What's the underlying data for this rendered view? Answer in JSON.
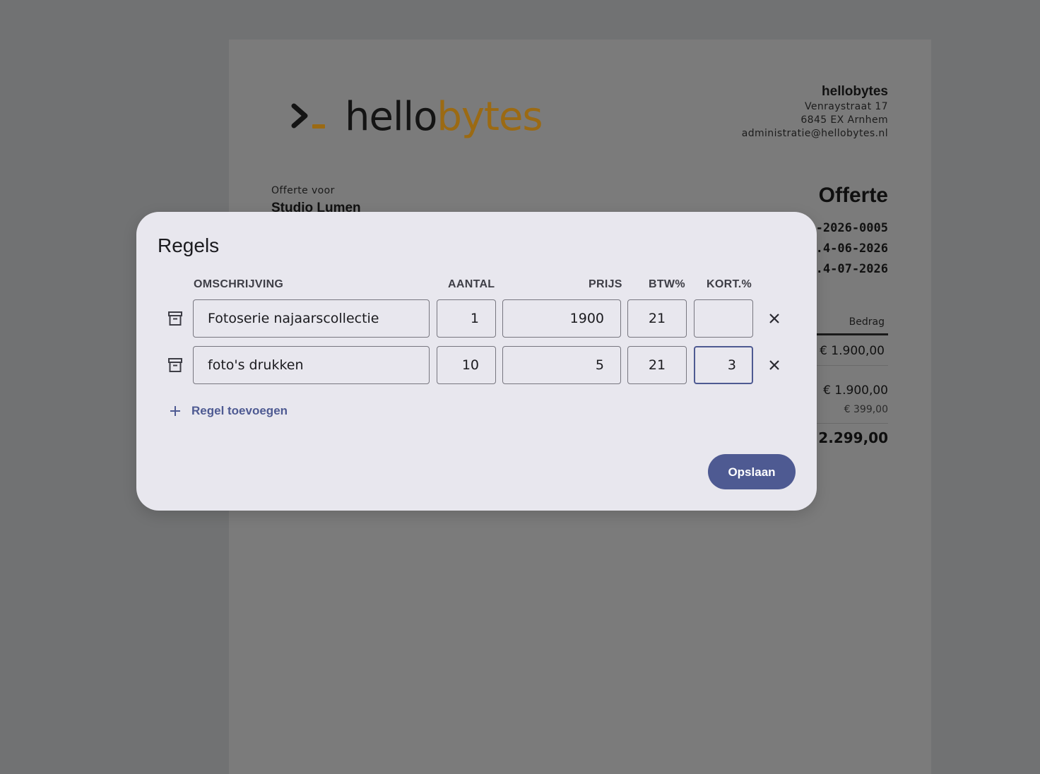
{
  "document": {
    "logo": {
      "part1": "hello",
      "part2": "bytes"
    },
    "company": {
      "name": "hellobytes",
      "street": "Venraystraat 17",
      "city": "6845 EX Arnhem",
      "email": "administratie@hellobytes.nl"
    },
    "recipient_label": "Offerte voor",
    "recipient_name": "Studio Lumen",
    "title": "Offerte",
    "meta_visible": [
      "-2026-0005",
      ".4-06-2026",
      ".4-07-2026"
    ],
    "amount_header": "Bedrag",
    "line_amount": "€ 1.900,00",
    "subtotal": "€ 1.900,00",
    "vat": "€ 399,00",
    "total": "€ 2.299,00"
  },
  "dialog": {
    "title": "Regels",
    "headers": {
      "description": "OMSCHRIJVING",
      "quantity": "AANTAL",
      "price": "PRIJS",
      "vat": "BTW%",
      "discount": "KORT.%"
    },
    "rows": [
      {
        "description": "Fotoserie najaarscollectie",
        "quantity": "1",
        "price": "1900",
        "vat": "21",
        "discount": ""
      },
      {
        "description": "foto's drukken",
        "quantity": "10",
        "price": "5",
        "vat": "21",
        "discount": "3"
      }
    ],
    "add_label": "Regel toevoegen",
    "save_label": "Opslaan"
  },
  "colors": {
    "accent": "#4e5a92",
    "logo_accent": "#9b6a13",
    "dialog_bg": "#e8e7ee",
    "scrim": "#717273"
  },
  "icons": [
    "archive-icon",
    "close-icon",
    "plus-icon",
    "logo-prompt-icon"
  ]
}
